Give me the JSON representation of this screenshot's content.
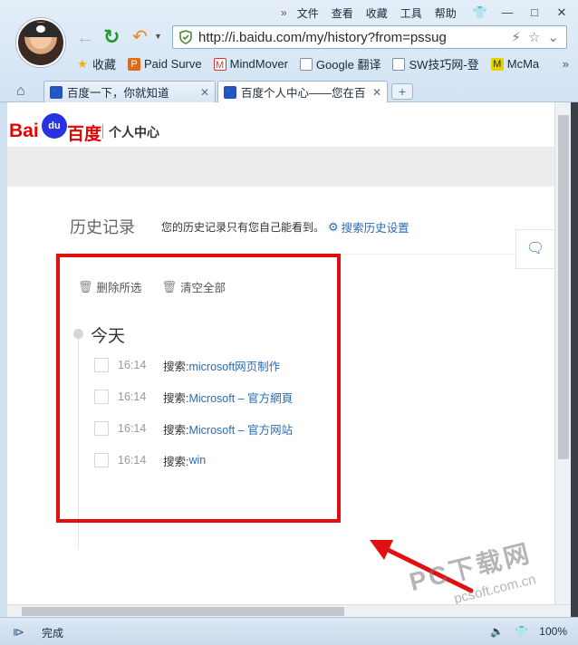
{
  "menubar": {
    "more": "»",
    "items": [
      "文件",
      "查看",
      "收藏",
      "工具",
      "帮助"
    ]
  },
  "window": {
    "controls": [
      "👕",
      "—",
      "□",
      "✕"
    ]
  },
  "address": {
    "url": "http://i.baidu.com/my/history?from=pssug"
  },
  "favorites": {
    "items": [
      {
        "label": "收藏",
        "icon": "★",
        "color": "#f2b10f"
      },
      {
        "label": "Paid Surve",
        "icon": "P",
        "color": "#e06a14"
      },
      {
        "label": "MindMover",
        "icon": "M",
        "color": "#d33"
      },
      {
        "label": "Google 翻译",
        "icon": "G",
        "color": "#7a8fa8"
      },
      {
        "label": "SW技巧网-登",
        "icon": "S",
        "color": "#7a8fa8"
      },
      {
        "label": "McMa",
        "icon": "M",
        "color": "#d8c800"
      }
    ],
    "more": "»"
  },
  "tabs": [
    {
      "title": "百度一下，你就知道",
      "close": "✕"
    },
    {
      "title": "百度个人中心——您在百",
      "close": "✕"
    }
  ],
  "new_tab": "+",
  "page": {
    "logo": {
      "bai": "Bai",
      "du": "du",
      "baidu": "百度",
      "center": "个人中心"
    },
    "history_title": "历史记录",
    "history_desc": "您的历史记录只有您自己能看到。",
    "history_settings": "搜索历史设置",
    "actions": {
      "delete_selected": "删除所选",
      "clear_all": "清空全部"
    },
    "day_label": "今天",
    "rows": [
      {
        "time": "16:14",
        "prefix": "搜索:",
        "query": "microsoft网页制作"
      },
      {
        "time": "16:14",
        "prefix": "搜索:",
        "query": "Microsoft – 官方網頁"
      },
      {
        "time": "16:14",
        "prefix": "搜索:",
        "query": "Microsoft – 官方网站"
      },
      {
        "time": "16:14",
        "prefix": "搜索:",
        "query": "win"
      }
    ]
  },
  "status": {
    "text": "完成",
    "zoom": "100%"
  },
  "watermark": {
    "main": "PC下载网",
    "sub": "pcsoft.com.cn"
  },
  "colors": {
    "accent": "#2a6bb5",
    "annotation": "#e01010",
    "baidu_red": "#e10602",
    "baidu_blue": "#2932e1"
  }
}
